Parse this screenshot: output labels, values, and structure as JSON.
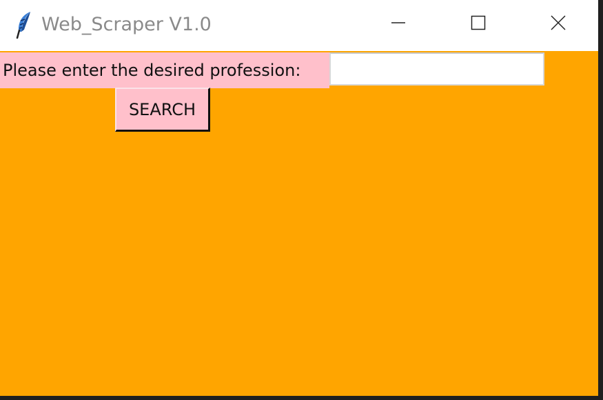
{
  "window": {
    "title": "Web_Scraper V1.0",
    "icon": "feather-icon",
    "controls": {
      "minimize_icon": "minimize-icon",
      "maximize_icon": "maximize-icon",
      "close_icon": "close-icon"
    }
  },
  "form": {
    "prompt_label": "Please enter the desired profession:",
    "profession_value": "",
    "search_label": "SEARCH"
  },
  "colors": {
    "background": "#ffa500",
    "label_background": "#ffc0cb",
    "button_background": "#ffc0cb",
    "titlebar": "#ffffff"
  }
}
